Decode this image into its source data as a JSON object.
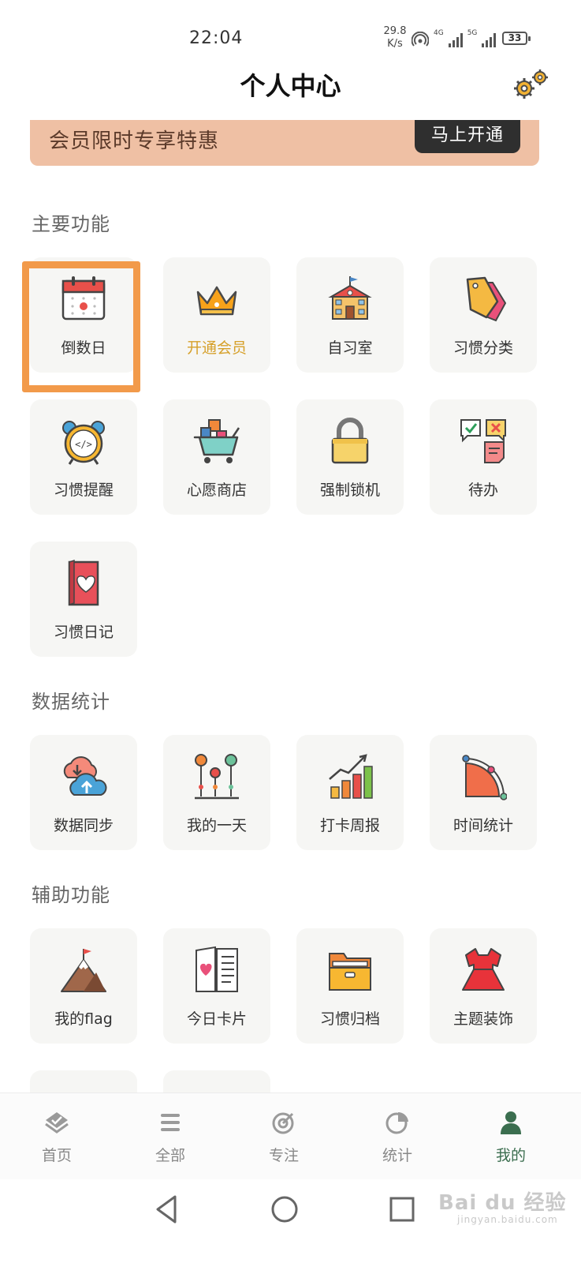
{
  "status_bar": {
    "time": "22:04",
    "net_speed_value": "29.8",
    "net_speed_unit": "K/s",
    "network_1": "4G",
    "network_2": "5G",
    "battery": "33"
  },
  "header": {
    "title": "个人中心",
    "settings_icon": "gear-icon"
  },
  "banner": {
    "text": "会员限时专享特惠",
    "button": "马上开通"
  },
  "sections": {
    "main": {
      "title": "主要功能",
      "items": [
        {
          "label": "倒数日",
          "icon": "calendar-icon"
        },
        {
          "label": "开通会员",
          "icon": "crown-icon"
        },
        {
          "label": "自习室",
          "icon": "school-building-icon"
        },
        {
          "label": "习惯分类",
          "icon": "tag-icon"
        },
        {
          "label": "习惯提醒",
          "icon": "alarm-clock-icon"
        },
        {
          "label": "心愿商店",
          "icon": "shopping-cart-icon"
        },
        {
          "label": "强制锁机",
          "icon": "padlock-icon"
        },
        {
          "label": "待办",
          "icon": "todo-notes-icon"
        },
        {
          "label": "习惯日记",
          "icon": "heart-diary-icon"
        }
      ]
    },
    "stats": {
      "title": "数据统计",
      "items": [
        {
          "label": "数据同步",
          "icon": "cloud-sync-icon"
        },
        {
          "label": "我的一天",
          "icon": "timeline-icon"
        },
        {
          "label": "打卡周报",
          "icon": "bar-growth-icon"
        },
        {
          "label": "时间统计",
          "icon": "pie-slice-icon"
        }
      ]
    },
    "assist": {
      "title": "辅助功能",
      "items": [
        {
          "label": "我的flag",
          "icon": "mountain-flag-icon"
        },
        {
          "label": "今日卡片",
          "icon": "card-book-icon"
        },
        {
          "label": "习惯归档",
          "icon": "folder-archive-icon"
        },
        {
          "label": "主题装饰",
          "icon": "dress-icon"
        }
      ]
    }
  },
  "bottom_nav": [
    {
      "label": "首页",
      "icon": "home-layers-icon"
    },
    {
      "label": "全部",
      "icon": "menu-lines-icon"
    },
    {
      "label": "专注",
      "icon": "target-icon"
    },
    {
      "label": "统计",
      "icon": "pie-chart-icon"
    },
    {
      "label": "我的",
      "icon": "user-icon",
      "active": true
    }
  ],
  "watermark": {
    "brand": "Bai du 经验",
    "domain": "jingyan.baidu.com"
  },
  "colors": {
    "banner_bg": "#efc0a4",
    "highlight": "#f29a4a",
    "tile_bg": "#f6f6f4",
    "gold_label": "#d6a02a",
    "active_nav": "#3b6e4f"
  }
}
